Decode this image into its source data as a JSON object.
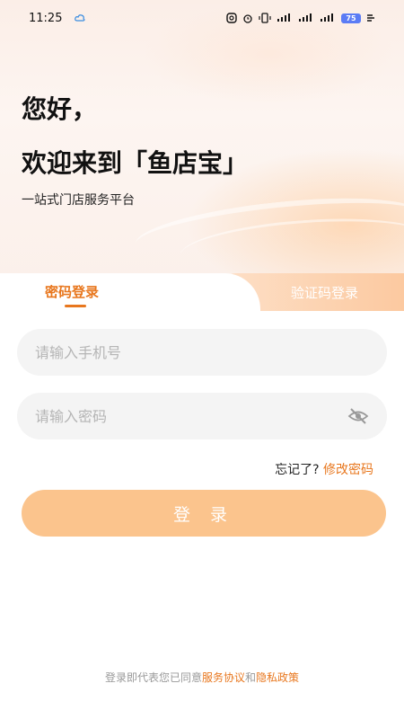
{
  "status_bar": {
    "time": "11:25",
    "battery": "75"
  },
  "hero": {
    "greeting": "您好，",
    "welcome": "欢迎来到「鱼店宝」",
    "tagline": "一站式门店服务平台"
  },
  "tabs": {
    "password_login": "密码登录",
    "code_login": "验证码登录"
  },
  "form": {
    "phone_placeholder": "请输入手机号",
    "password_placeholder": "请输入密码",
    "forgot_text": "忘记了?",
    "reset_link": "修改密码",
    "login_button": "登 录"
  },
  "agreement": {
    "prefix": "登录即代表您已同意",
    "service": "服务协议",
    "and": "和",
    "privacy": "隐私政策"
  },
  "colors": {
    "accent": "#e8771e",
    "button": "#fbc48d",
    "field_bg": "#f4f4f4"
  }
}
